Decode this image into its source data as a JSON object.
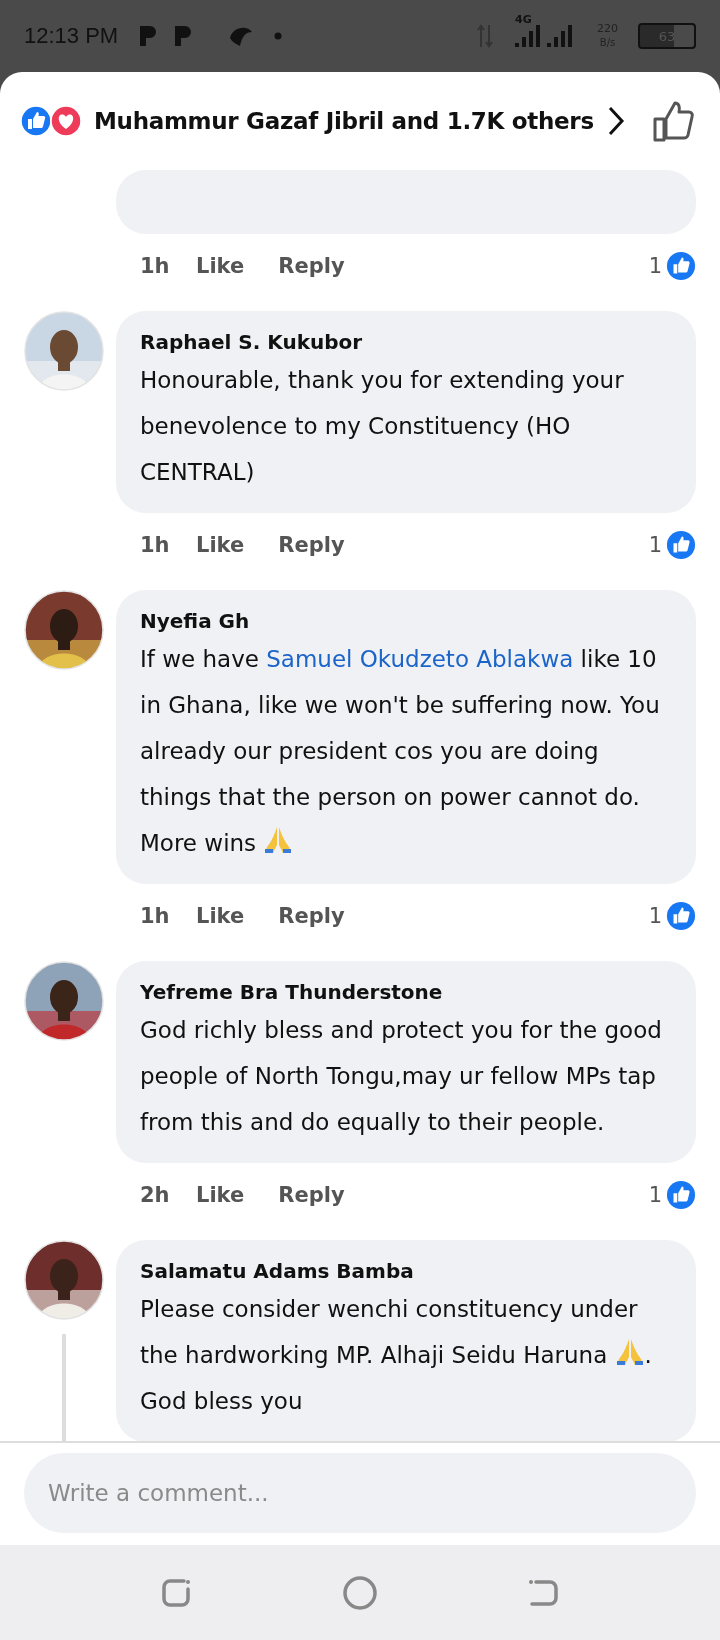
{
  "status_bar": {
    "time": "12:13 PM",
    "network": "4G",
    "speed": "220",
    "speed_unit": "B/s",
    "battery": "63"
  },
  "header": {
    "reactions_text": "Muhammur Gazaf Jibril and 1.7K others"
  },
  "previous_comment": {
    "time": "1h",
    "like": "Like",
    "reply": "Reply",
    "reactions": "1"
  },
  "comments": [
    {
      "name": "Raphael S. Kukubor",
      "body": [
        {
          "kind": "text",
          "text": "Honourable, thank you for extending your benevolence to my Constituency (HO CENTRAL)"
        }
      ],
      "time": "1h",
      "like": "Like",
      "reply": "Reply",
      "reactions": "1",
      "has_replies": false
    },
    {
      "name": "Nyefia Gh",
      "body": [
        {
          "kind": "text",
          "text": "If we have "
        },
        {
          "kind": "mention",
          "text": "Samuel Okudzeto Ablakwa"
        },
        {
          "kind": "text",
          "text": " like 10 in Ghana, like we won't be suffering now. You already our president cos you are doing things that the person on power cannot do. More wins "
        },
        {
          "kind": "pray"
        }
      ],
      "time": "1h",
      "like": "Like",
      "reply": "Reply",
      "reactions": "1",
      "has_replies": false
    },
    {
      "name": "Yefreme Bra Thunderstone",
      "body": [
        {
          "kind": "text",
          "text": "God richly bless and protect you for the good people of North Tongu,may ur fellow MPs tap from this and do equally to their people."
        }
      ],
      "time": "2h",
      "like": "Like",
      "reply": "Reply",
      "reactions": "1",
      "has_replies": false
    },
    {
      "name": "Salamatu Adams Bamba",
      "body": [
        {
          "kind": "text",
          "text": "Please consider wenchi constituency under the hardworking MP. Alhaji Seidu Haruna "
        },
        {
          "kind": "pray"
        },
        {
          "kind": "text",
          "text": ". God bless you"
        }
      ],
      "has_replies": true
    }
  ],
  "composer": {
    "placeholder": "Write a comment..."
  }
}
